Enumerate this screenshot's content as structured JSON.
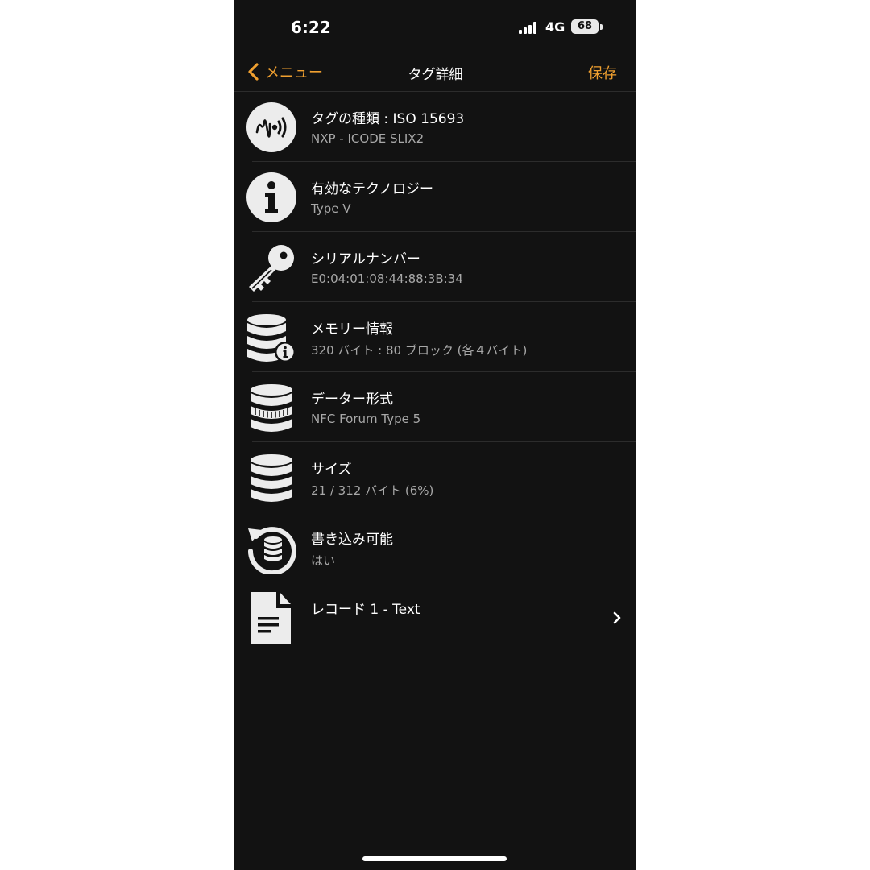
{
  "status_bar": {
    "time": "6:22",
    "network": "4G",
    "battery": "68"
  },
  "nav": {
    "back_label": "メニュー",
    "title": "タグ詳細",
    "save_label": "保存"
  },
  "colors": {
    "accent": "#f0a030",
    "background": "#121212",
    "text": "#ffffff",
    "subtext": "#a8a8a8"
  },
  "rows": [
    {
      "icon": "nfc-tag-icon",
      "title": "タグの種類 : ISO 15693",
      "subtitle": "NXP - ICODE SLIX2"
    },
    {
      "icon": "info-icon",
      "title": "有効なテクノロジー",
      "subtitle": "Type V"
    },
    {
      "icon": "key-icon",
      "title": "シリアルナンバー",
      "subtitle": "E0:04:01:08:44:88:3B:34"
    },
    {
      "icon": "database-info-icon",
      "title": "メモリー情報",
      "subtitle": "320 バイト : 80 ブロック (各４バイト)"
    },
    {
      "icon": "database-format-icon",
      "title": "データー形式",
      "subtitle": "NFC Forum Type 5"
    },
    {
      "icon": "database-icon",
      "title": "サイズ",
      "subtitle": "21 / 312 バイト (6%)"
    },
    {
      "icon": "database-refresh-icon",
      "title": "書き込み可能",
      "subtitle": "はい"
    },
    {
      "icon": "document-icon",
      "title": "レコード 1 - Text",
      "subtitle": ""
    }
  ]
}
